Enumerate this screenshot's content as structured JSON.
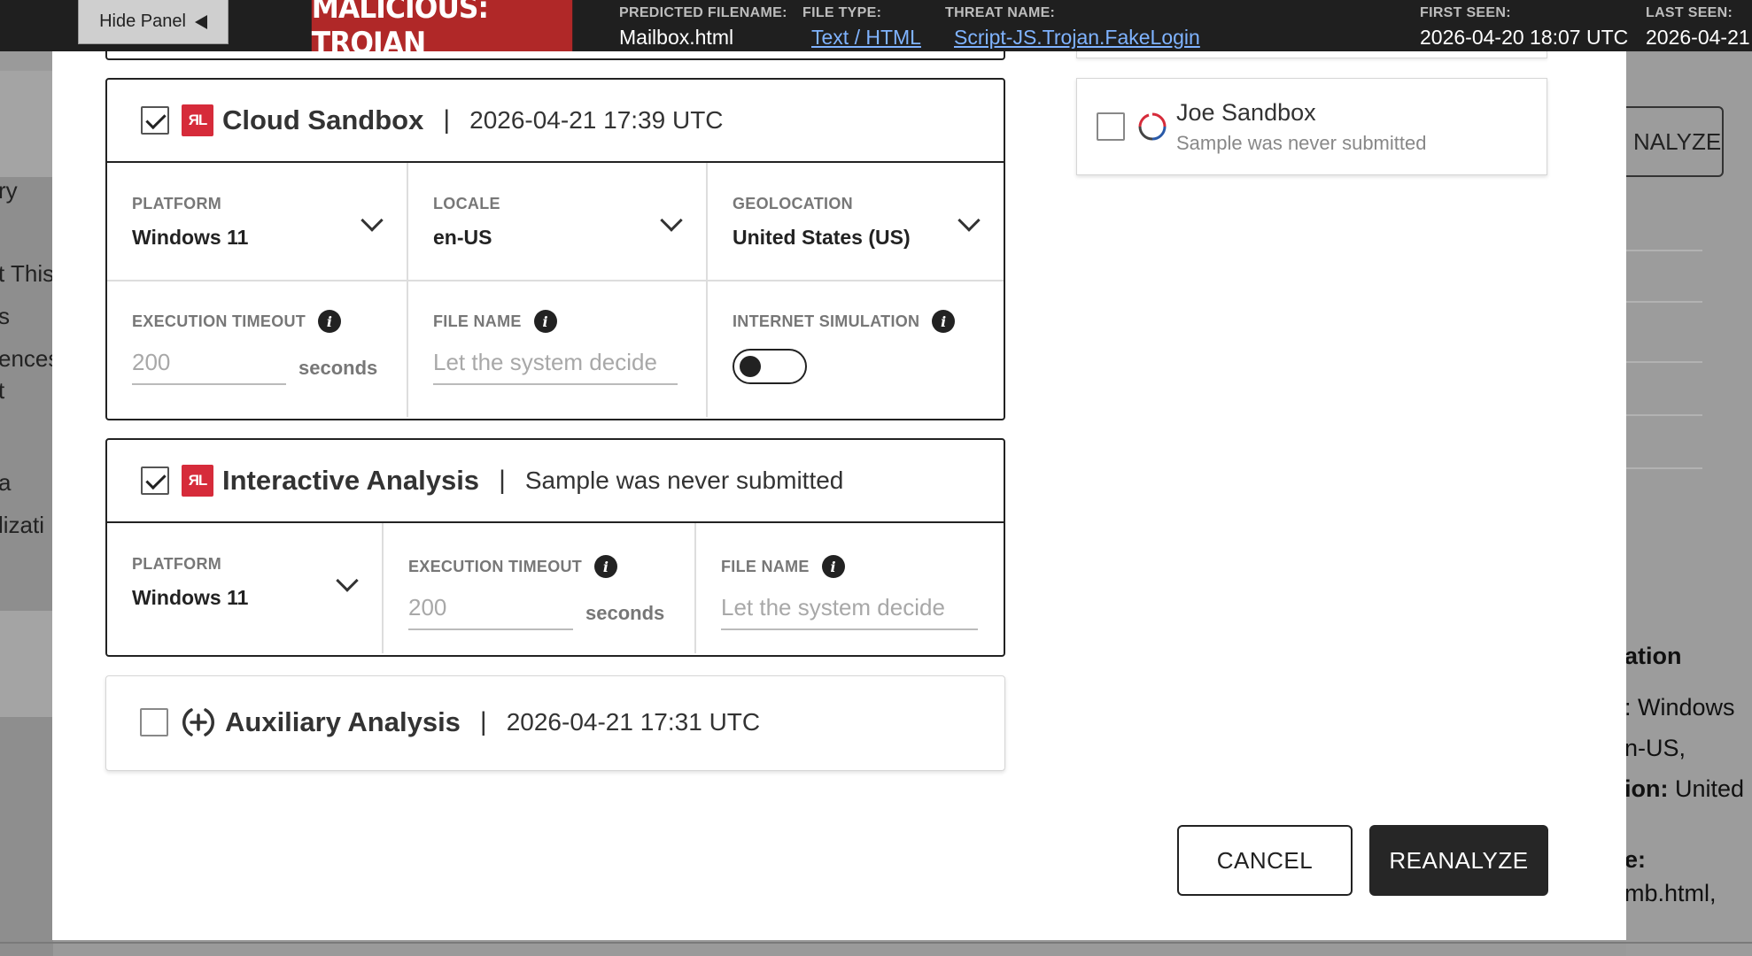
{
  "background": {
    "left_fragments": [
      "ry",
      "t This",
      "s",
      "ences",
      "t",
      "a",
      "lizati"
    ],
    "right_button": "NALYZE",
    "right_fragments": {
      "heading": "ation",
      "line1": ": Windows",
      "line2": "n-US,",
      "line3_bold": "ion:",
      "line3": " United",
      "line4_bold": "e:",
      "line5": "mb.html,"
    }
  },
  "topbar": {
    "hide_panel": "Hide Panel",
    "verdict": "MALICIOUS: TROJAN",
    "predicted_filename_label": "PREDICTED FILENAME:",
    "predicted_filename": "Mailbox.html",
    "file_type_label": "FILE TYPE:",
    "file_type": "Text / HTML",
    "threat_name_label": "THREAT NAME:",
    "threat_name": "Script-JS.Trojan.FakeLogin",
    "first_seen_label": "FIRST SEEN:",
    "first_seen": "2026-04-20 18:07 UTC",
    "last_seen_label": "LAST SEEN:",
    "last_seen": "2026-04-21"
  },
  "cloud_sandbox": {
    "title": "Cloud Sandbox",
    "sep": "|",
    "date": "2026-04-21 17:39 UTC",
    "logo": "ЯL",
    "checked": true,
    "platform_label": "PLATFORM",
    "platform": "Windows 11",
    "locale_label": "LOCALE",
    "locale": "en-US",
    "geolocation_label": "GEOLOCATION",
    "geolocation": "United States (US)",
    "timeout_label": "EXECUTION TIMEOUT",
    "timeout_placeholder": "200",
    "timeout_unit": "seconds",
    "filename_label": "FILE NAME",
    "filename_placeholder": "Let the system decide",
    "internet_label": "INTERNET SIMULATION"
  },
  "interactive": {
    "title": "Interactive Analysis",
    "sep": "|",
    "status": "Sample was never submitted",
    "logo": "ЯL",
    "checked": true,
    "platform_label": "PLATFORM",
    "platform": "Windows 11",
    "timeout_label": "EXECUTION TIMEOUT",
    "timeout_placeholder": "200",
    "timeout_unit": "seconds",
    "filename_label": "FILE NAME",
    "filename_placeholder": "Let the system decide"
  },
  "auxiliary": {
    "title": "Auxiliary Analysis",
    "sep": "|",
    "date": "2026-04-21 17:31 UTC",
    "checked": false
  },
  "joe_sandbox": {
    "title": "Joe Sandbox",
    "status": "Sample was never submitted",
    "checked": false
  },
  "icons": {
    "info": "i",
    "info_icon": "info-icon",
    "chevron": "chevron-down-icon",
    "rl_logo": "reversinglabs-logo-icon",
    "aux": "plus-circle-icon",
    "joe": "joe-sandbox-logo-icon"
  },
  "colors": {
    "verdict_bg": "#b02828",
    "rl_red": "#d62b3a",
    "link": "#7fb3ff",
    "primary_button": "#262626"
  },
  "actions": {
    "cancel": "CANCEL",
    "reanalyze": "REANALYZE"
  }
}
